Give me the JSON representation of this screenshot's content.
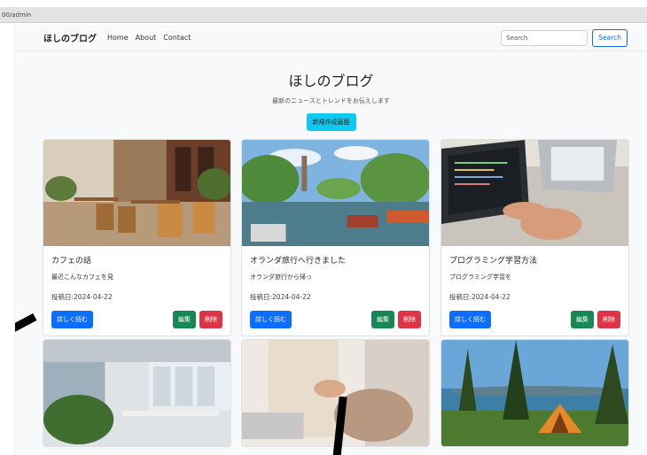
{
  "browser": {
    "url": "00/admin"
  },
  "navbar": {
    "brand": "ほしのブログ",
    "links": [
      "Home",
      "About",
      "Contact"
    ],
    "search_placeholder": "Search",
    "search_button": "Search"
  },
  "hero": {
    "title": "ほしのブログ",
    "subtitle": "最新のニュースとトレンドをお伝えします",
    "new_button": "新規作成画面"
  },
  "cards": [
    {
      "title": "カフェの話",
      "excerpt": "最近こんなカフェを見",
      "date": "投稿日:2024-04-22",
      "read": "詳しく読む",
      "edit": "編集",
      "delete": "削除"
    },
    {
      "title": "オランダ旅行へ行きました",
      "excerpt": "オランダ旅行から帰っ",
      "date": "投稿日:2024-04-22",
      "read": "詳しく読む",
      "edit": "編集",
      "delete": "削除"
    },
    {
      "title": "プログラミング学習方法",
      "excerpt": "プログラミング学習を",
      "date": "投稿日:2024-04-22",
      "read": "詳しく読む",
      "edit": "編集",
      "delete": "削除"
    }
  ],
  "colors": {
    "primary": "#0d6efd",
    "success": "#198754",
    "danger": "#dc3545",
    "info": "#0dcaf0"
  },
  "images": [
    "cafe-terrace-photo",
    "amsterdam-canal-photo",
    "laptop-coding-photo",
    "office-interior-photo",
    "handshake-photo",
    "camping-tent-photo"
  ]
}
